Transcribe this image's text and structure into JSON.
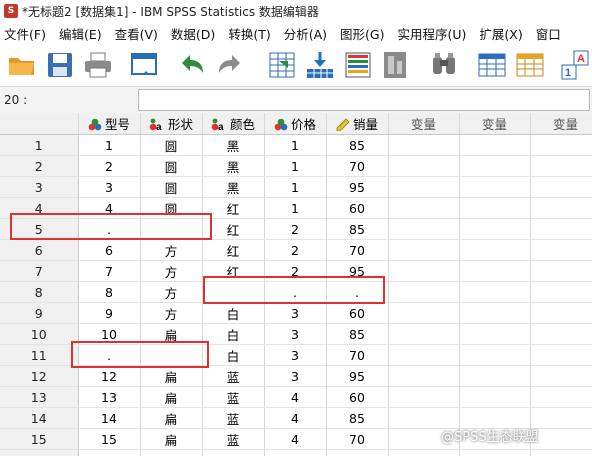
{
  "window": {
    "title": "*无标题2 [数据集1] - IBM SPSS Statistics 数据编辑器"
  },
  "menu": [
    "文件(F)",
    "编辑(E)",
    "查看(V)",
    "数据(D)",
    "转换(T)",
    "分析(A)",
    "图形(G)",
    "实用程序(U)",
    "扩展(X)",
    "窗口"
  ],
  "toolbar": {
    "icons": [
      "open-folder-icon",
      "save-icon",
      "print-icon",
      "dialog-recall-icon",
      "undo-icon",
      "redo-icon",
      "goto-case-icon",
      "goto-variable-icon",
      "variables-icon",
      "run-descriptive-icon",
      "find-icon",
      "insert-cases-icon",
      "insert-variable-icon",
      "value-labels-icon"
    ],
    "colors": {
      "folder": "#f2a93b",
      "save": "#3a6fb3",
      "undo": "#2e8b3e",
      "redo": "#8c8c8c",
      "accent": "#2a6ebb"
    }
  },
  "cell_editor": {
    "ref": "20 :",
    "value": ""
  },
  "columns": [
    {
      "label": "型号",
      "icon": "nominal-variable-icon"
    },
    {
      "label": "形状",
      "icon": "string-variable-icon"
    },
    {
      "label": "颜色",
      "icon": "string-variable-icon"
    },
    {
      "label": "价格",
      "icon": "nominal-variable-icon"
    },
    {
      "label": "销量",
      "icon": "scale-variable-icon"
    },
    {
      "label": "变量",
      "icon": ""
    },
    {
      "label": "变量",
      "icon": ""
    },
    {
      "label": "变量",
      "icon": ""
    }
  ],
  "rows": [
    {
      "n": "1",
      "cells": [
        "1",
        "圆",
        "黑",
        "1",
        "85",
        "",
        "",
        ""
      ]
    },
    {
      "n": "2",
      "cells": [
        "2",
        "圆",
        "黑",
        "1",
        "70",
        "",
        "",
        ""
      ]
    },
    {
      "n": "3",
      "cells": [
        "3",
        "圆",
        "黑",
        "1",
        "95",
        "",
        "",
        ""
      ]
    },
    {
      "n": "4",
      "cells": [
        "4",
        "圆",
        "红",
        "1",
        "60",
        "",
        "",
        ""
      ]
    },
    {
      "n": "5",
      "cells": [
        ".",
        "",
        "红",
        "2",
        "85",
        "",
        "",
        ""
      ]
    },
    {
      "n": "6",
      "cells": [
        "6",
        "方",
        "红",
        "2",
        "70",
        "",
        "",
        ""
      ]
    },
    {
      "n": "7",
      "cells": [
        "7",
        "方",
        "红",
        "2",
        "95",
        "",
        "",
        ""
      ]
    },
    {
      "n": "8",
      "cells": [
        "8",
        "方",
        "",
        ".",
        ".",
        "",
        "",
        ""
      ]
    },
    {
      "n": "9",
      "cells": [
        "9",
        "方",
        "白",
        "3",
        "60",
        "",
        "",
        ""
      ]
    },
    {
      "n": "10",
      "cells": [
        "10",
        "扁",
        "白",
        "3",
        "85",
        "",
        "",
        ""
      ]
    },
    {
      "n": "11",
      "cells": [
        ".",
        "",
        "白",
        "3",
        "70",
        "",
        "",
        ""
      ]
    },
    {
      "n": "12",
      "cells": [
        "12",
        "扁",
        "蓝",
        "3",
        "95",
        "",
        "",
        ""
      ]
    },
    {
      "n": "13",
      "cells": [
        "13",
        "扁",
        "蓝",
        "4",
        "60",
        "",
        "",
        ""
      ]
    },
    {
      "n": "14",
      "cells": [
        "14",
        "扁",
        "蓝",
        "4",
        "85",
        "",
        "",
        ""
      ]
    },
    {
      "n": "15",
      "cells": [
        "15",
        "扁",
        "蓝",
        "4",
        "70",
        "",
        "",
        ""
      ]
    },
    {
      "n": "16",
      "cells": [
        "",
        "",
        "",
        "",
        "",
        "",
        "",
        ""
      ]
    }
  ],
  "highlight_color": "#e03030",
  "watermark": "@SPSS生态联盟"
}
